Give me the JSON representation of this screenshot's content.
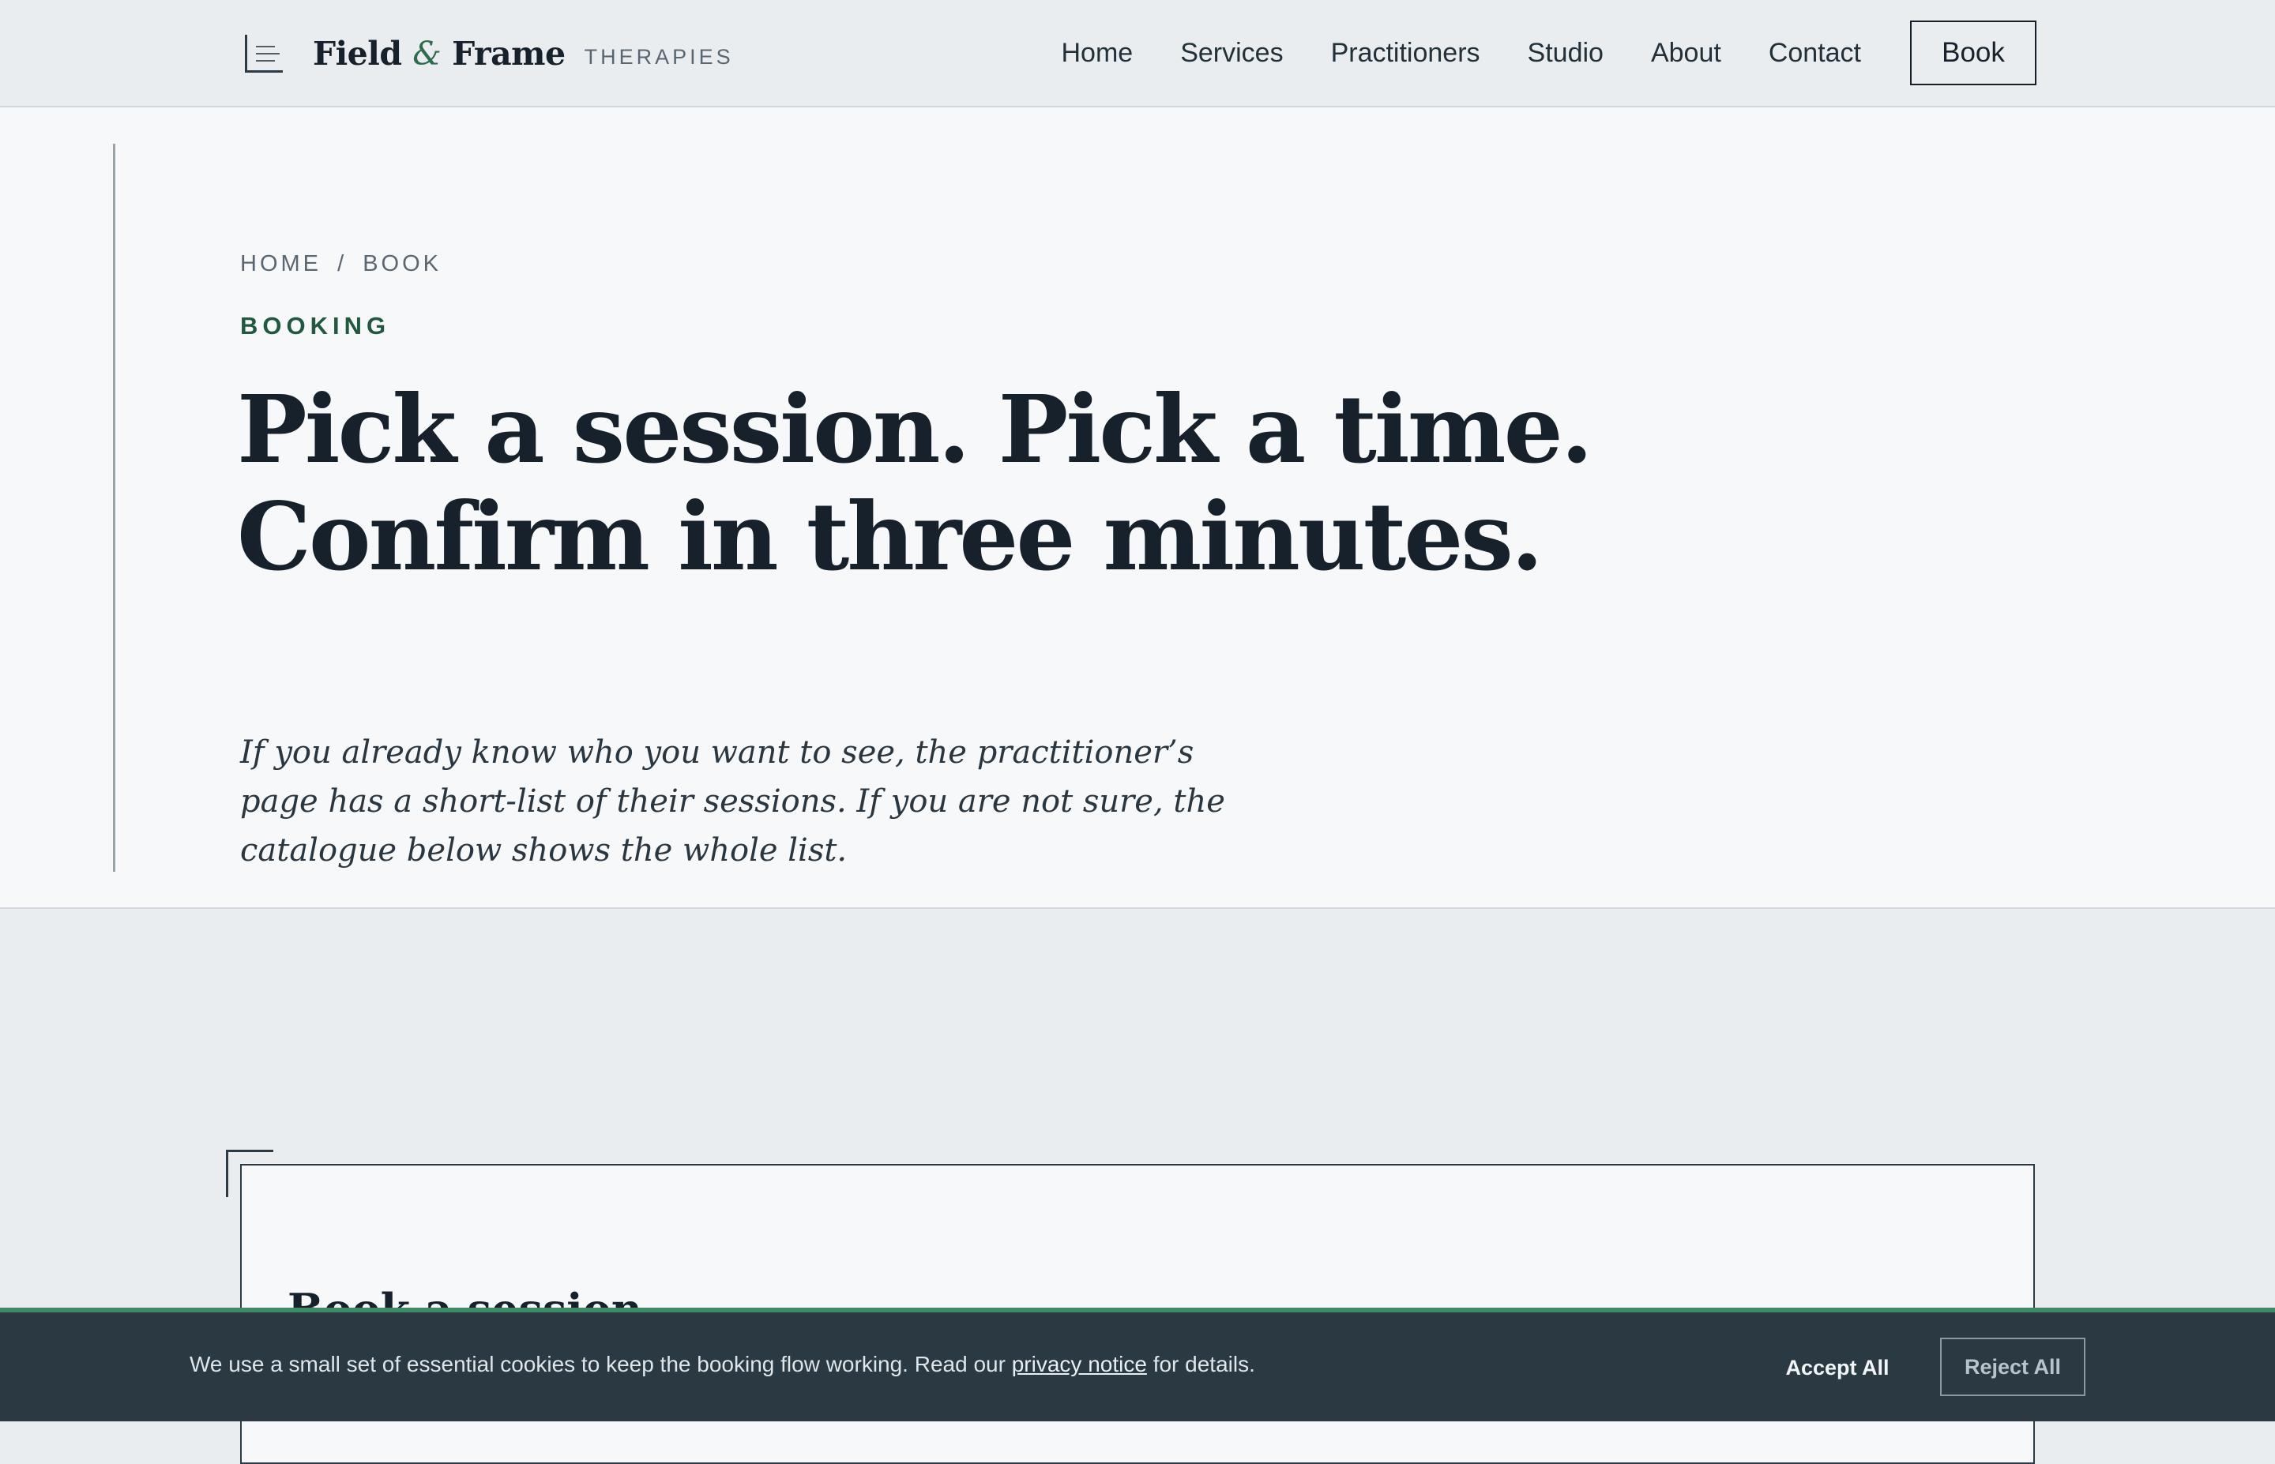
{
  "header": {
    "brand": {
      "name_part1": "Field",
      "amp": "&",
      "name_part2": "Frame",
      "subtitle": "THERAPIES"
    },
    "nav": {
      "home": "Home",
      "services": "Services",
      "practitioners": "Practitioners",
      "studio": "Studio",
      "about": "About",
      "contact": "Contact"
    },
    "book_button": "Book"
  },
  "hero": {
    "breadcrumb": {
      "home": "HOME",
      "sep": "/",
      "current": "BOOK"
    },
    "eyebrow": "BOOKING",
    "title_line1": "Pick a session. Pick a time.",
    "title_line2": "Confirm in three minutes.",
    "lede": "If you already know who you want to see, the practitioner’s page has a short-list of their sessions. If you are not sure, the catalogue below shows the whole list."
  },
  "card": {
    "title": "Book a session"
  },
  "cookie": {
    "text_before": "We use a small set of essential cookies to keep the booking flow working. Read our",
    "link": "privacy notice",
    "text_after": "for details.",
    "accept": "Accept All",
    "reject": "Reject All"
  },
  "colors": {
    "accent_green": "#2e6b4f",
    "ink": "#17212b",
    "banner_bg": "#2a3942",
    "banner_accent": "#3f8a66"
  },
  "icons": {
    "brand": "bracket-lines-logo-icon"
  }
}
